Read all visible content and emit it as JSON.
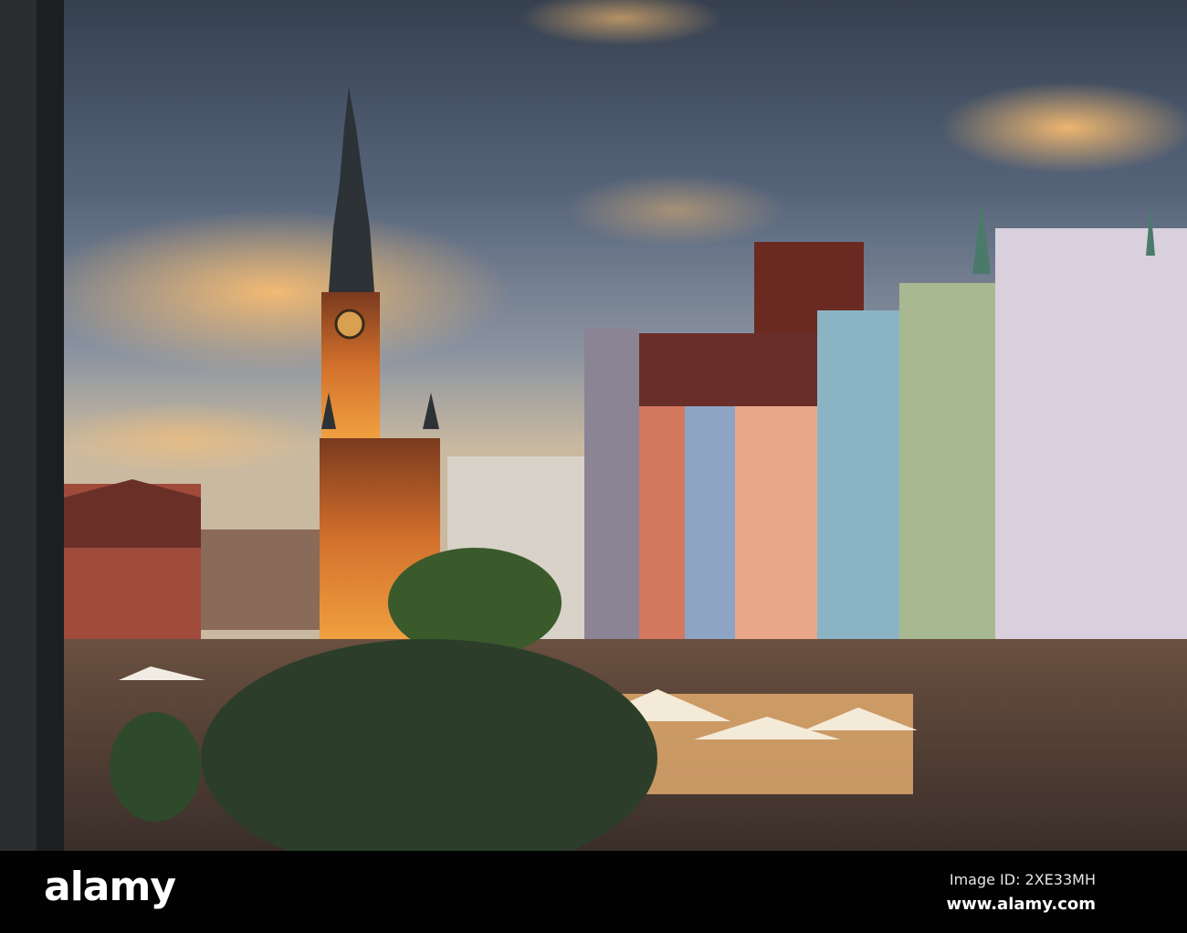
{
  "watermark": {
    "logo": "alamy",
    "image_id": "Image ID: 2XE33MH",
    "website": "www.alamy.com"
  },
  "colors": {
    "sky_top": "#3b4658",
    "sky_glow": "#f0a860",
    "tower": "#c8642a",
    "bar": "#020202"
  }
}
